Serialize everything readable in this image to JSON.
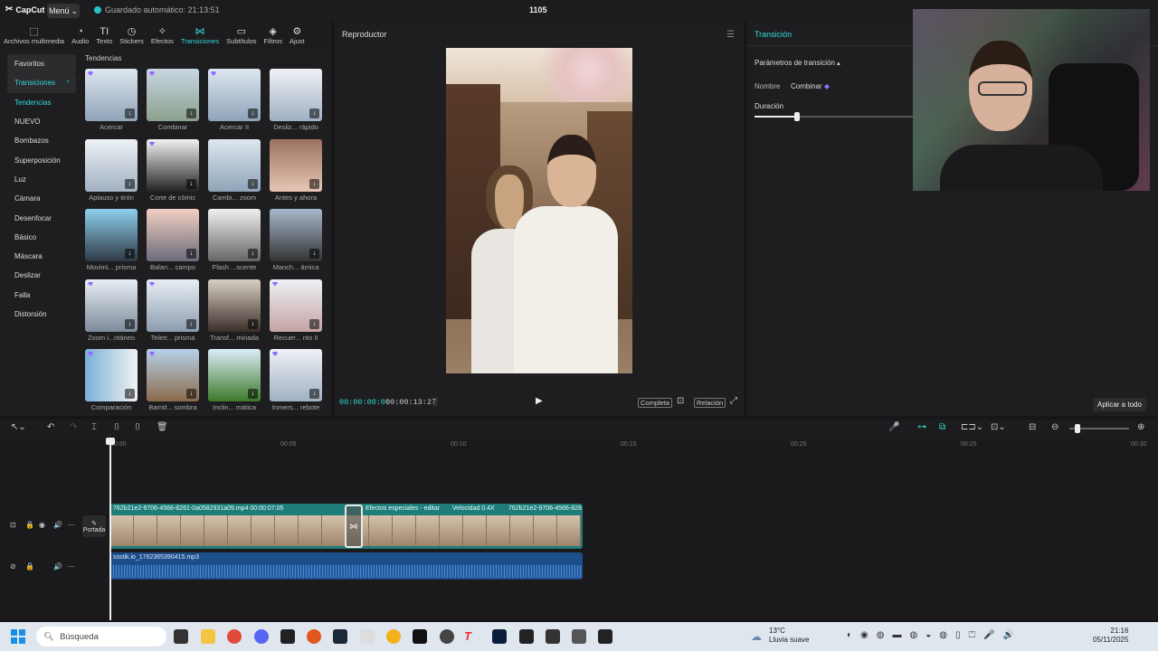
{
  "app": {
    "logo": "CapCut",
    "menu": "Menú",
    "autosave": "Guardado automático: 21:13:51",
    "project_title": "1105"
  },
  "toolbar": [
    {
      "label": "Archivos multimedia",
      "icon": "media-icon",
      "glyph": "⬚"
    },
    {
      "label": "Audio",
      "icon": "audio-icon",
      "glyph": "◔"
    },
    {
      "label": "Texto",
      "icon": "text-icon",
      "glyph": "TI"
    },
    {
      "label": "Stickers",
      "icon": "sticker-icon",
      "glyph": "◷"
    },
    {
      "label": "Efectos",
      "icon": "effects-icon",
      "glyph": "✧"
    },
    {
      "label": "Transiciones",
      "icon": "transitions-icon",
      "glyph": "⋈"
    },
    {
      "label": "Subtítulos",
      "icon": "subtitles-icon",
      "glyph": "▭"
    },
    {
      "label": "Filtros",
      "icon": "filters-icon",
      "glyph": "◈"
    },
    {
      "label": "Ajust",
      "icon": "adjust-icon",
      "glyph": "⚙"
    }
  ],
  "categories": [
    "Favoritos",
    "Transiciones",
    "Tendencias",
    "NUEVO",
    "Bombazos",
    "Superposición",
    "Luz",
    "Cámara",
    "Desenfocar",
    "Básico",
    "Máscara",
    "Deslizar",
    "Falla",
    "Distorsión"
  ],
  "trends_label": "Tendencias",
  "transitions": [
    "Acercar",
    "Combinar",
    "Acercar II",
    "Desliz... rápido",
    "Aplauso y tirón",
    "Corte de cómic",
    "Cambi... zoom",
    "Antes y ahora",
    "Movimi... prisma",
    "Balan... campo",
    "Flash ...scente",
    "Manch... ámica",
    "Zoom i...ntáneo",
    "Teletr... prisma",
    "Transf... minada",
    "Recuer... nto II",
    "Comparación",
    "Barrid... sombra",
    "Inclin... mática",
    "Inmers... rebote"
  ],
  "player": {
    "title": "Reproductor",
    "current_time": "00:00:00:00",
    "total_time": "00:00:13:27",
    "complete_btn": "Completa",
    "ratio_btn": "Relación"
  },
  "right_panel": {
    "title": "Transición",
    "params": "Parámetros de transición",
    "name_label": "Nombre",
    "name_value": "Combinar",
    "duration_label": "Duración",
    "apply_all": "Aplicar a todo",
    "duration_fraction": 0.27
  },
  "timeline": {
    "ruler": [
      "00:00",
      "00:05",
      "00:10",
      "00:15",
      "00:20",
      "00:25",
      "00:30"
    ],
    "video_clip_label": "762b21e2-9706-4566-8261-0a0582931a09.mp4   00:00:07:05",
    "effects_label": "Efectos especiales - editar",
    "speed_label": "Velocidad 0.4X",
    "video_clip2_label": "762b21e2-9706-4566-826",
    "audio_clip_label": "ssstik.io_1762365390415.mp3",
    "cover_label": "Portada"
  },
  "taskbar": {
    "search_placeholder": "Búsqueda",
    "weather_temp": "13°C",
    "weather_desc": "Lluvia suave",
    "time": "21:16",
    "date": "05/11/2025"
  },
  "colors": {
    "accent": "#33d7d7",
    "video_track": "#1f7d7a",
    "audio_track": "#1d4e8c"
  }
}
